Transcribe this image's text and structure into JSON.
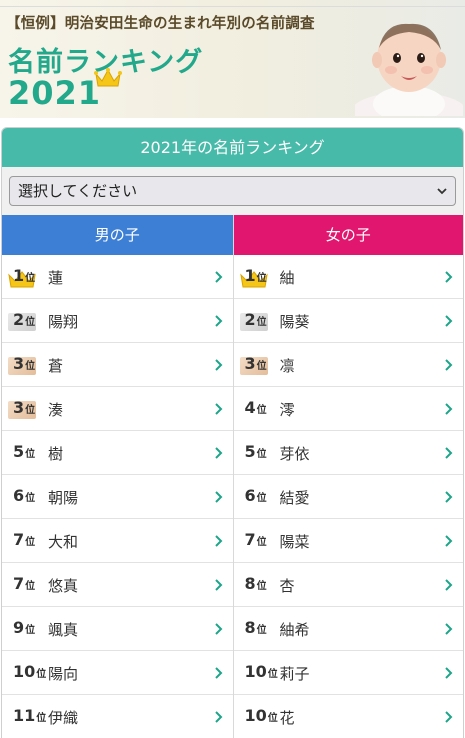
{
  "banner": {
    "subtitle": "【恒例】明治安田生命の生まれ年別の名前調査",
    "title": "名前ランキング",
    "year": "2021"
  },
  "ranking": {
    "header": "2021年の名前ランキング",
    "select_value": "選択してください",
    "rank_unit": "位",
    "boys": {
      "label": "男の子",
      "color": "#3e7fd6",
      "items": [
        {
          "rank": "1",
          "name": "蓮",
          "medal": "gold"
        },
        {
          "rank": "2",
          "name": "陽翔",
          "medal": "silver"
        },
        {
          "rank": "3",
          "name": "蒼",
          "medal": "bronze"
        },
        {
          "rank": "3",
          "name": "湊",
          "medal": "bronze"
        },
        {
          "rank": "5",
          "name": "樹",
          "medal": ""
        },
        {
          "rank": "6",
          "name": "朝陽",
          "medal": ""
        },
        {
          "rank": "7",
          "name": "大和",
          "medal": ""
        },
        {
          "rank": "7",
          "name": "悠真",
          "medal": ""
        },
        {
          "rank": "9",
          "name": "颯真",
          "medal": ""
        },
        {
          "rank": "10",
          "name": "陽向",
          "medal": ""
        },
        {
          "rank": "11",
          "name": "伊織",
          "medal": ""
        }
      ]
    },
    "girls": {
      "label": "女の子",
      "color": "#e0166f",
      "items": [
        {
          "rank": "1",
          "name": "紬",
          "medal": "gold"
        },
        {
          "rank": "2",
          "name": "陽葵",
          "medal": "silver"
        },
        {
          "rank": "3",
          "name": "凛",
          "medal": "bronze"
        },
        {
          "rank": "4",
          "name": "澪",
          "medal": ""
        },
        {
          "rank": "5",
          "name": "芽依",
          "medal": ""
        },
        {
          "rank": "6",
          "name": "結愛",
          "medal": ""
        },
        {
          "rank": "7",
          "name": "陽菜",
          "medal": ""
        },
        {
          "rank": "8",
          "name": "杏",
          "medal": ""
        },
        {
          "rank": "8",
          "name": "紬希",
          "medal": ""
        },
        {
          "rank": "10",
          "name": "莉子",
          "medal": ""
        },
        {
          "rank": "10",
          "name": "花",
          "medal": ""
        }
      ]
    }
  },
  "colors": {
    "teal": "#48baa9",
    "chevron": "#1ea58a",
    "gold": "#f5c518"
  },
  "icons": {
    "row_arrow": "chevron-right-icon",
    "select_arrow": "chevron-down-icon",
    "top_rank": "crown-icon"
  }
}
